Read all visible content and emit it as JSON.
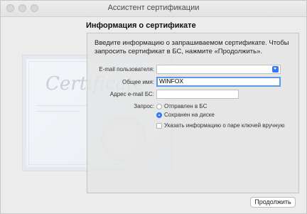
{
  "window": {
    "title": "Ассистент сертификации"
  },
  "heading": "Информация о сертификате",
  "intro": "Введите информацию о запрашиваемом сертификате. Чтобы запросить сертификат в БС, нажмите «Продолжить».",
  "form": {
    "email_label": "E-mail пользователя:",
    "email_value": "",
    "common_name_label": "Общее имя:",
    "common_name_value": "WINFOX",
    "ca_email_label": "Адрес e-mail БС:",
    "ca_email_value": "",
    "request_label": "Запрос:",
    "request_options": [
      {
        "label": "Отправлен в БС",
        "selected": false
      },
      {
        "label": "Сохранен на диске",
        "selected": true
      }
    ],
    "keypair_checkbox": {
      "label": "Указать информацию о паре ключей вручную",
      "checked": false
    }
  },
  "background_art": {
    "script_text": "Certificate"
  },
  "continue_button": "Продолжить",
  "colors": {
    "accent": "#3478f6",
    "focus_ring": "#5b98e5"
  }
}
